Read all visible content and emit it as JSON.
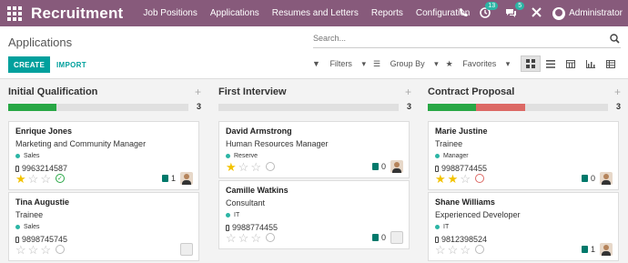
{
  "app": {
    "brand": "Recruitment",
    "menu": [
      "Job Positions",
      "Applications",
      "Resumes and Letters",
      "Reports",
      "Configuration"
    ],
    "badges": {
      "activities": "13",
      "messages": "5"
    },
    "user": "Administrator"
  },
  "control": {
    "title": "Applications",
    "search_placeholder": "Search...",
    "create_label": "CREATE",
    "import_label": "IMPORT",
    "filters_label": "Filters",
    "groupby_label": "Group By",
    "favorites_label": "Favorites",
    "views": [
      "kanban-icon",
      "list-icon",
      "calendar-icon",
      "graph-icon",
      "pivot-icon"
    ],
    "active_view": "kanban"
  },
  "colors": {
    "brand": "#875a7b",
    "accent": "#00a09d",
    "green": "#28a745",
    "red": "#dc6965",
    "star": "#f3c300"
  },
  "columns": [
    {
      "title": "Initial Qualification",
      "count": "3",
      "progress": [
        {
          "color": "#28a745",
          "share": 0.27
        }
      ],
      "cards": [
        {
          "name": "Enrique Jones",
          "job": "Marketing and Community Manager",
          "tag": "Sales",
          "phone": "9963214587",
          "stars": 1,
          "activity": "ok",
          "docs": "1",
          "avatar": true
        },
        {
          "name": "Tina Augustie",
          "job": "Trainee",
          "tag": "Sales",
          "phone": "9898745745",
          "stars": 0,
          "activity": "none",
          "docs": "",
          "avatar": false
        }
      ]
    },
    {
      "title": "First Interview",
      "count": "3",
      "progress": [],
      "cards": [
        {
          "name": "David Armstrong",
          "job": "Human Resources Manager",
          "tag": "Reserve",
          "phone": "",
          "stars": 1,
          "activity": "none",
          "docs": "0",
          "avatar": true
        },
        {
          "name": "Camille Watkins",
          "job": "Consultant",
          "tag": "IT",
          "phone": "9988774455",
          "stars": 0,
          "activity": "none",
          "docs": "0",
          "avatar": false
        }
      ]
    },
    {
      "title": "Contract Proposal",
      "count": "3",
      "progress": [
        {
          "color": "#28a745",
          "share": 0.27
        },
        {
          "color": "#dc6965",
          "share": 0.27
        }
      ],
      "cards": [
        {
          "name": "Marie Justine",
          "job": "Trainee",
          "tag": "Manager",
          "phone": "9988774455",
          "stars": 2,
          "activity": "late",
          "docs": "0",
          "avatar": true
        },
        {
          "name": "Shane Williams",
          "job": "Experienced Developer",
          "tag": "IT",
          "phone": "9812398524",
          "stars": 0,
          "activity": "none",
          "docs": "1",
          "avatar": true
        }
      ]
    }
  ]
}
